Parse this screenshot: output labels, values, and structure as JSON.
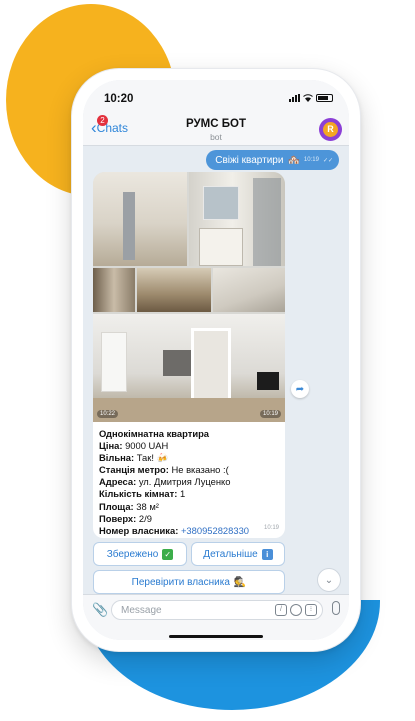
{
  "status": {
    "time": "10:20"
  },
  "nav": {
    "back_label": "Chats",
    "unread_count": "2",
    "title": "РУМС БОТ",
    "subtitle": "bot",
    "avatar_letter": "R"
  },
  "outgoing": {
    "text": "Свіжі квартири",
    "emoji": "🏘️",
    "time": "10:19"
  },
  "photos": {
    "time_small": "10:22",
    "time_large": "10:19"
  },
  "listing": {
    "title": "Однокімнатна квартира",
    "price_label": "Ціна:",
    "price_value": "9000 UAH",
    "free_label": "Вільна:",
    "free_value": "Так! 🍻",
    "metro_label": "Станція метро:",
    "metro_value": "Не вказано :(",
    "address_label": "Адреса:",
    "address_value": "ул. Дмитрия Луценко",
    "rooms_label": "Кількість кімнат:",
    "rooms_value": "1",
    "area_label": "Площа:",
    "area_value": "38 м²",
    "floor_label": "Поверх:",
    "floor_value": "2/9",
    "owner_phone_label": "Номер власника:",
    "owner_phone_value": "+380952828330",
    "time": "10:19"
  },
  "buttons": {
    "saved": "Збережено",
    "saved_emoji": "✓",
    "details": "Детальніше",
    "details_emoji": "i",
    "check_owner": "Перевірити власника",
    "check_owner_emoji": "🕵️"
  },
  "input": {
    "placeholder": "Message"
  },
  "colors": {
    "accent": "#4d95d9",
    "blob_yellow": "#f6b21e",
    "blob_blue": "#1d93df"
  }
}
